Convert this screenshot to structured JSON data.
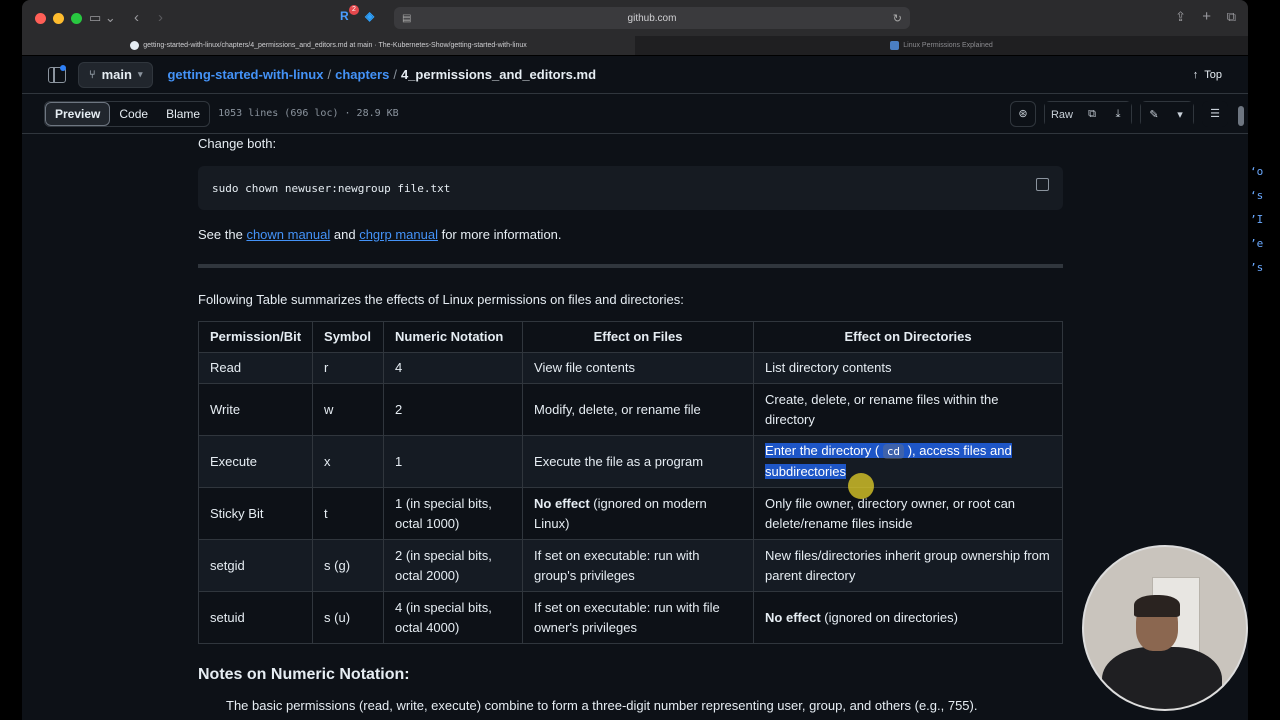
{
  "browser": {
    "url": "github.com",
    "tabs": [
      {
        "title": "getting-started-with-linux/chapters/4_permissions_and_editors.md at main · The-Kubernetes-Show/getting-started-with-linux",
        "active": true
      },
      {
        "title": "Linux Permissions Explained",
        "active": false
      }
    ],
    "extension_badge": "2"
  },
  "repo_header": {
    "branch": "main",
    "crumb_repo": "getting-started-with-linux",
    "crumb_dir": "chapters",
    "sep": "/",
    "file": "4_permissions_and_editors.md",
    "top_label": "Top"
  },
  "toolbar": {
    "preview": "Preview",
    "code": "Code",
    "blame": "Blame",
    "meta": "1053 lines (696 loc) · 28.9 KB",
    "raw": "Raw"
  },
  "content": {
    "change_both": "Change both:",
    "code": "sudo chown newuser:newgroup file.txt",
    "see_pre": "See the ",
    "see_link1": "chown manual",
    "see_mid": " and ",
    "see_link2": "chgrp manual",
    "see_post": " for more information.",
    "table_intro": "Following Table summarizes the effects of Linux permissions on files and directories:",
    "table": {
      "headers": [
        "Permission/Bit",
        "Symbol",
        "Numeric Notation",
        "Effect on Files",
        "Effect on Directories"
      ],
      "rows": [
        [
          "Read",
          "r",
          "4",
          "View file contents",
          "List directory contents"
        ],
        [
          "Write",
          "w",
          "2",
          "Modify, delete, or rename file",
          "Create, delete, or rename files within the directory"
        ],
        [
          "Execute",
          "x",
          "1",
          "Execute the file as a program",
          ""
        ],
        [
          "Sticky Bit",
          "t",
          "1 (in special bits, octal 1000)",
          "",
          "Only file owner, directory owner, or root can delete/rename files inside"
        ],
        [
          "setgid",
          "s (g)",
          "2 (in special bits, octal 2000)",
          "If set on executable: run with group's privileges",
          "New files/directories inherit group ownership from parent directory"
        ],
        [
          "setuid",
          "s (u)",
          "4 (in special bits, octal 4000)",
          "If set on executable: run with file owner's privileges",
          ""
        ]
      ],
      "execute_dir_pre": "Enter the directory (",
      "execute_dir_code": "cd",
      "execute_dir_post": "), access files and subdirectories",
      "sticky_files_bold": "No effect",
      "sticky_files_rest": " (ignored on modern Linux)",
      "setuid_dir_bold": "No effect",
      "setuid_dir_rest": " (ignored on directories)"
    },
    "notes_heading": "Notes on Numeric Notation:",
    "notes_line": "The basic permissions (read, write, execute) combine to form a three-digit number representing user, group, and others (e.g., 755)."
  },
  "side_window_glyphs": [
    "‘o",
    "‘s",
    "’I",
    "’e",
    "’s"
  ]
}
